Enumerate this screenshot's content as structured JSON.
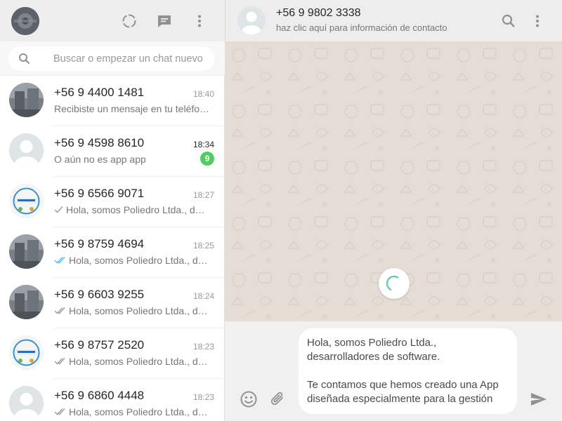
{
  "colors": {
    "header_bg": "#ededed",
    "chat_bg": "#e5ddd5",
    "unread_badge": "#4fce5d",
    "read_tick": "#4fc3f7",
    "icon_gray": "#919191"
  },
  "sidebar": {
    "header_icons": [
      "status-icon",
      "new-chat-icon",
      "menu-icon"
    ],
    "search": {
      "placeholder": "Buscar o empezar un chat nuevo",
      "value": ""
    },
    "chats": [
      {
        "name": "+56 9 4400 1481",
        "time": "18:40",
        "preview": "Recibiste un mensaje en tu teléfono",
        "tick": "none",
        "unread": "",
        "avatar": "photo"
      },
      {
        "name": "+56 9 4598 8610",
        "time": "18:34",
        "preview": "O aún no es app app",
        "tick": "none",
        "unread": "9",
        "avatar": "default"
      },
      {
        "name": "+56 9 6566 9071",
        "time": "18:27",
        "preview": "Hola, somos Poliedro Ltda., desarrolladores",
        "tick": "single",
        "unread": "",
        "avatar": "logo"
      },
      {
        "name": "+56 9 8759 4694",
        "time": "18:25",
        "preview": "Hola, somos Poliedro Ltda., desarrolladores",
        "tick": "double-read",
        "unread": "",
        "avatar": "photo"
      },
      {
        "name": "+56 9 6603 9255",
        "time": "18:24",
        "preview": "Hola, somos Poliedro Ltda., desarrolladores",
        "tick": "double",
        "unread": "",
        "avatar": "photo"
      },
      {
        "name": "+56 9 8757 2520",
        "time": "18:23",
        "preview": "Hola, somos Poliedro Ltda., desarrolladores",
        "tick": "double",
        "unread": "",
        "avatar": "logo"
      },
      {
        "name": "+56 9 6860 4448",
        "time": "18:23",
        "preview": "Hola, somos Poliedro Ltda., desarrolladores",
        "tick": "double",
        "unread": "",
        "avatar": "default"
      }
    ]
  },
  "conversation": {
    "contact_name": "+56 9 9802 3338",
    "contact_sub": "haz clic aquí para información de contacto",
    "header_icons": [
      "search-icon",
      "menu-icon"
    ],
    "loading": true
  },
  "composer": {
    "text": "Hola, somos Poliedro Ltda., desarrolladores de software.\n\nTe contamos que hemos creado una App diseñada especialmente para la gestión",
    "icons": [
      "emoji-icon",
      "attach-icon",
      "send-icon"
    ]
  }
}
